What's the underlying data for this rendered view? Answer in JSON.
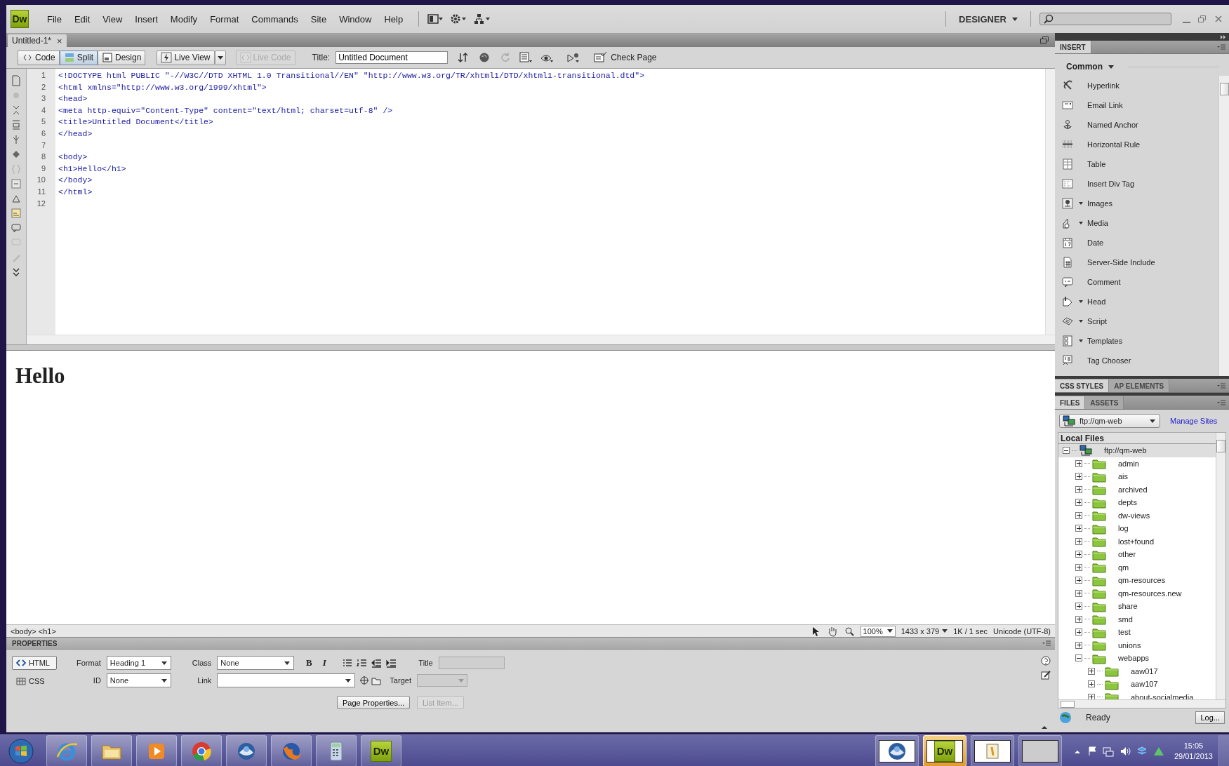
{
  "app": {
    "logo": "Dw"
  },
  "menu": [
    "File",
    "Edit",
    "View",
    "Insert",
    "Modify",
    "Format",
    "Commands",
    "Site",
    "Window",
    "Help"
  ],
  "workspace": "DESIGNER",
  "document_tabs": [
    {
      "label": "Untitled-1*",
      "close": "×",
      "selected": true
    }
  ],
  "toolbar": {
    "views": [
      {
        "label": "Code",
        "selected": false
      },
      {
        "label": "Split",
        "selected": true
      },
      {
        "label": "Design",
        "selected": false
      }
    ],
    "live_view": {
      "label": "Live View",
      "disabled": false
    },
    "live_code": {
      "label": "Live Code",
      "disabled": true
    },
    "title_label": "Title:",
    "title_value": "Untitled Document",
    "check_page": "Check Page"
  },
  "code": {
    "lines": [
      {
        "number": "1",
        "text": "<!DOCTYPE html PUBLIC \"-//W3C//DTD XHTML 1.0 Transitional//EN\" \"http://www.w3.org/TR/xhtml1/DTD/xhtml1-transitional.dtd\">"
      },
      {
        "number": "2",
        "text": "<html xmlns=\"http://www.w3.org/1999/xhtml\">"
      },
      {
        "number": "3",
        "text": "<head>"
      },
      {
        "number": "4",
        "text": "<meta http-equiv=\"Content-Type\" content=\"text/html; charset=utf-8\" />"
      },
      {
        "number": "5",
        "text": "<title>Untitled Document</title>"
      },
      {
        "number": "6",
        "text": "</head>"
      },
      {
        "number": "7"
      },
      {
        "number": "8",
        "text": "<body>"
      },
      {
        "number": "9",
        "text": "<h1>Hello</h1>"
      },
      {
        "number": "10",
        "text": "</body>"
      },
      {
        "number": "11",
        "text": "</html>"
      },
      {
        "number": "12"
      }
    ]
  },
  "design": {
    "heading": "Hello"
  },
  "status_bar": {
    "tags": "<body> <h1>",
    "zoom": "100%",
    "size": "1433 x 379",
    "download": "1K / 1 sec",
    "encoding": "Unicode (UTF-8)"
  },
  "properties": {
    "title": "PROPERTIES",
    "modes": [
      {
        "label": "HTML",
        "selected": true
      },
      {
        "label": "CSS",
        "selected": false
      }
    ],
    "format_label": "Format",
    "format_value": "Heading 1",
    "id_label": "ID",
    "id_value": "None",
    "class_label": "Class",
    "class_value": "None",
    "link_label": "Link",
    "bold": "B",
    "italic": "I",
    "title_label": "Title",
    "target_label": "Target",
    "buttons": [
      {
        "label": "Page Properties...",
        "disabled": false
      },
      {
        "label": "List Item...",
        "disabled": true
      }
    ]
  },
  "insert_panel": {
    "tab": "INSERT",
    "category": "Common",
    "items": [
      {
        "label": "Hyperlink",
        "menu": false
      },
      {
        "label": "Email Link",
        "menu": false
      },
      {
        "label": "Named Anchor",
        "menu": false
      },
      {
        "label": "Horizontal Rule",
        "menu": false
      },
      {
        "label": "Table",
        "menu": false
      },
      {
        "label": "Insert Div Tag",
        "menu": false
      },
      {
        "label": "Images",
        "menu": true
      },
      {
        "label": "Media",
        "menu": true
      },
      {
        "label": "Date",
        "menu": false
      },
      {
        "label": "Server-Side Include",
        "menu": false
      },
      {
        "label": "Comment",
        "menu": false
      },
      {
        "label": "Head",
        "menu": true
      },
      {
        "label": "Script",
        "menu": true
      },
      {
        "label": "Templates",
        "menu": true
      },
      {
        "label": "Tag Chooser",
        "menu": false
      }
    ]
  },
  "panel_tabs": [
    {
      "label": "CSS STYLES",
      "selected": true
    },
    {
      "label": "AP ELEMENTS",
      "selected": false
    }
  ],
  "files_tabs": [
    {
      "label": "FILES",
      "selected": true
    },
    {
      "label": "ASSETS",
      "selected": false
    }
  ],
  "files": {
    "site": "ftp://qm-web",
    "manage": "Manage Sites",
    "header": "Local Files",
    "tree": [
      {
        "label": "ftp://qm-web",
        "kind": "site",
        "expanded": true,
        "selected": true,
        "children": [
          {
            "label": "admin",
            "kind": "folder",
            "expanded": false,
            "selected": false
          },
          {
            "label": "ais",
            "kind": "folder",
            "expanded": false,
            "selected": false
          },
          {
            "label": "archived",
            "kind": "folder",
            "expanded": false,
            "selected": false
          },
          {
            "label": "depts",
            "kind": "folder",
            "expanded": false,
            "selected": false
          },
          {
            "label": "dw-views",
            "kind": "folder",
            "expanded": false,
            "selected": false
          },
          {
            "label": "log",
            "kind": "folder",
            "expanded": false,
            "selected": false
          },
          {
            "label": "lost+found",
            "kind": "folder",
            "expanded": false,
            "selected": false
          },
          {
            "label": "other",
            "kind": "folder",
            "expanded": false,
            "selected": false
          },
          {
            "label": "qm",
            "kind": "folder",
            "expanded": false,
            "selected": false
          },
          {
            "label": "qm-resources",
            "kind": "folder",
            "expanded": false,
            "selected": false
          },
          {
            "label": "qm-resources.new",
            "kind": "folder",
            "expanded": false,
            "selected": false
          },
          {
            "label": "share",
            "kind": "folder",
            "expanded": false,
            "selected": false
          },
          {
            "label": "smd",
            "kind": "folder",
            "expanded": false,
            "selected": false
          },
          {
            "label": "test",
            "kind": "folder",
            "expanded": false,
            "selected": false
          },
          {
            "label": "unions",
            "kind": "folder",
            "expanded": false,
            "selected": false
          },
          {
            "label": "webapps",
            "kind": "folder",
            "expanded": true,
            "selected": false,
            "children": [
              {
                "label": "aaw017",
                "kind": "folder",
                "expanded": false,
                "selected": false
              },
              {
                "label": "aaw107",
                "kind": "folder",
                "expanded": false,
                "selected": false
              },
              {
                "label": "about-socialmedia",
                "kind": "folder",
                "expanded": false,
                "selected": false
              }
            ]
          }
        ]
      }
    ],
    "status": "Ready",
    "log_button": "Log..."
  },
  "taskbar": {
    "apps": [
      {
        "kind": "start"
      },
      {
        "kind": "browser-e"
      },
      {
        "kind": "folder"
      },
      {
        "kind": "player"
      },
      {
        "kind": "chrome"
      },
      {
        "kind": "bird"
      },
      {
        "kind": "fox"
      },
      {
        "kind": "calculator"
      },
      {
        "kind": "dw",
        "label": "Dw"
      }
    ],
    "windows": [
      {
        "kind": "bird",
        "selected": false
      },
      {
        "kind": "dw",
        "label": "Dw",
        "selected": true
      },
      {
        "kind": "document",
        "selected": false
      },
      {
        "kind": "blank",
        "selected": false
      }
    ],
    "time": "15:05",
    "date": "29/01/2013"
  }
}
